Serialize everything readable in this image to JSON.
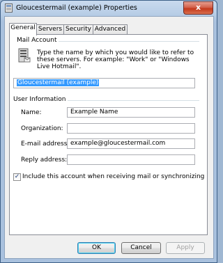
{
  "window": {
    "title": "Gloucestermail (example) Properties",
    "close_glyph": "x"
  },
  "tabs": [
    {
      "label": "General",
      "active": true
    },
    {
      "label": "Servers",
      "active": false
    },
    {
      "label": "Security",
      "active": false
    },
    {
      "label": "Advanced",
      "active": false
    }
  ],
  "mail_account": {
    "group_label": "Mail Account",
    "description": "Type the name by which you would like to refer to these servers.  For example: \"Work\" or \"Windows Live Hotmail\".",
    "account_name": "Gloucestermail (example)"
  },
  "user_info": {
    "group_label": "User Information",
    "name_label": "Name:",
    "name_value": "Example Name",
    "organization_label": "Organization:",
    "organization_value": "",
    "email_label": "E-mail address:",
    "email_value": "example@gloucestermail.com",
    "reply_label": "Reply address:",
    "reply_value": ""
  },
  "include_checkbox": {
    "label": "Include this account when receiving mail or synchronizing",
    "checked": true,
    "mark": "✓"
  },
  "buttons": {
    "ok": "OK",
    "cancel": "Cancel",
    "apply": "Apply"
  }
}
